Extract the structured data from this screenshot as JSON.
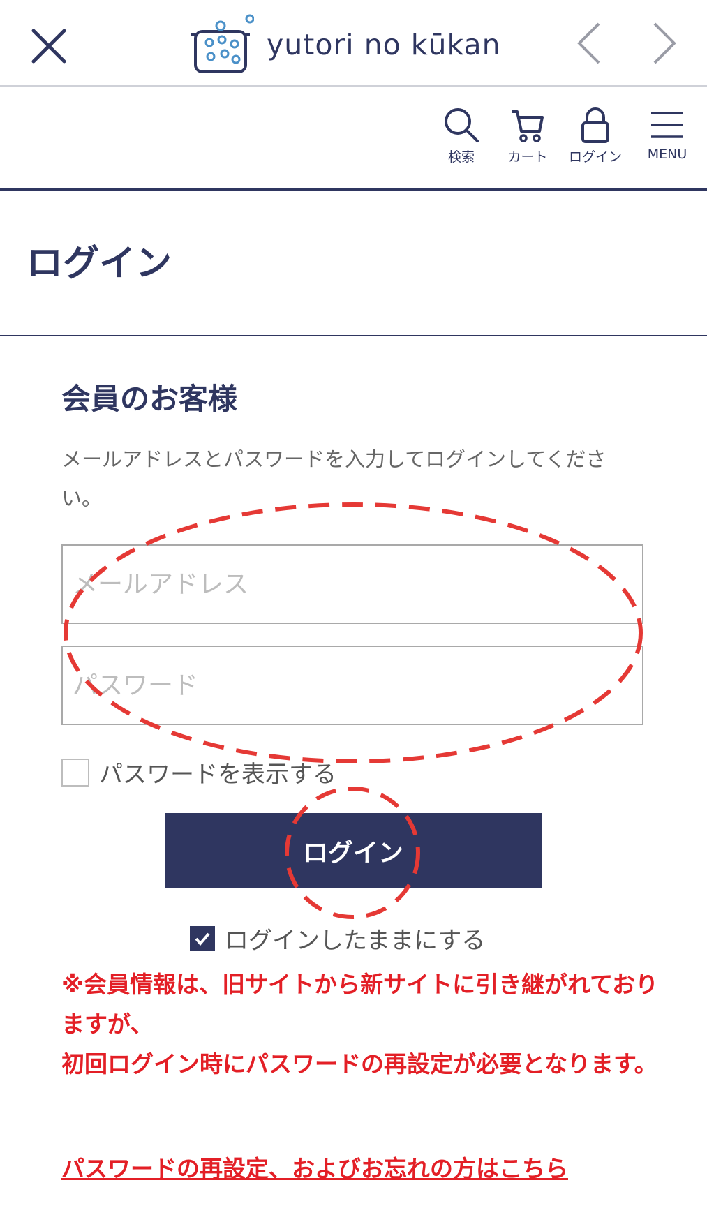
{
  "browser_bar": {
    "logo_text": "yutori no kūkan"
  },
  "header": {
    "items": [
      {
        "label": "検索",
        "icon": "search-icon"
      },
      {
        "label": "カート",
        "icon": "cart-icon"
      },
      {
        "label": "ログイン",
        "icon": "lock-icon"
      },
      {
        "label": "MENU",
        "icon": "menu-icon"
      }
    ]
  },
  "page": {
    "title": "ログイン"
  },
  "member_section": {
    "title": "会員のお客様",
    "instruction": "メールアドレスとパスワードを入力してログインしてください。",
    "email_placeholder": "メールアドレス",
    "password_placeholder": "パスワード",
    "show_password_label": "パスワードを表示する",
    "show_password_checked": false,
    "login_button": "ログイン",
    "stay_logged_in_label": "ログインしたままにする",
    "stay_logged_in_checked": true
  },
  "notice": {
    "line1": "※会員情報は、旧サイトから新サイトに引き継がれておりますが、",
    "line2": "初回ログイン時にパスワードの再設定が必要となります。"
  },
  "reset_link": "パスワードの再設定、およびお忘れの方はこちら",
  "colors": {
    "brand": "#2f3660",
    "notice": "#e31f26",
    "annotation": "#e53935"
  }
}
